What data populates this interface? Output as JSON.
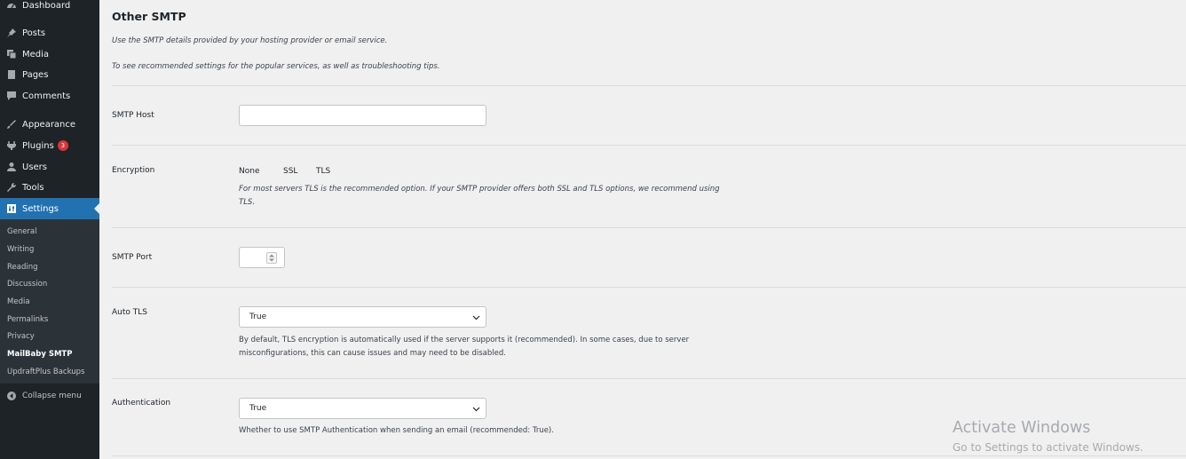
{
  "sidebar": {
    "items": [
      {
        "id": "dashboard",
        "label": "Dashboard",
        "icon": "dashboard-icon"
      },
      {
        "id": "posts",
        "label": "Posts",
        "icon": "pushpin-icon"
      },
      {
        "id": "media",
        "label": "Media",
        "icon": "media-icon"
      },
      {
        "id": "pages",
        "label": "Pages",
        "icon": "page-icon"
      },
      {
        "id": "comments",
        "label": "Comments",
        "icon": "comment-icon"
      },
      {
        "id": "appearance",
        "label": "Appearance",
        "icon": "brush-icon"
      },
      {
        "id": "plugins",
        "label": "Plugins",
        "icon": "plugin-icon",
        "badge": "3"
      },
      {
        "id": "users",
        "label": "Users",
        "icon": "user-icon"
      },
      {
        "id": "tools",
        "label": "Tools",
        "icon": "wrench-icon"
      },
      {
        "id": "settings",
        "label": "Settings",
        "icon": "settings-icon",
        "active": true
      }
    ],
    "submenu": [
      "General",
      "Writing",
      "Reading",
      "Discussion",
      "Media",
      "Permalinks",
      "Privacy",
      "MailBaby SMTP",
      "UpdraftPlus Backups"
    ],
    "current_submenu": "MailBaby SMTP",
    "collapse_label": "Collapse menu"
  },
  "main": {
    "title": "Other SMTP",
    "desc1": "Use the SMTP details provided by your hosting provider or email service.",
    "desc2": "To see recommended settings for the popular services, as well as troubleshooting tips.",
    "smtp_host": {
      "label": "SMTP Host",
      "value": ""
    },
    "encryption": {
      "label": "Encryption",
      "options": [
        "None",
        "SSL",
        "TLS"
      ],
      "help": "For most servers TLS is the recommended option. If your SMTP provider offers both SSL and TLS options, we recommend using TLS."
    },
    "smtp_port": {
      "label": "SMTP Port",
      "value": ""
    },
    "auto_tls": {
      "label": "Auto TLS",
      "value": "True",
      "help": "By default, TLS encryption is automatically used if the server supports it (recommended). In some cases, due to server misconfigurations, this can cause issues and may need to be disabled."
    },
    "authentication": {
      "label": "Authentication",
      "value": "True",
      "help": "Whether to use SMTP Authentication when sending an email (recommended: True)."
    }
  },
  "watermark": {
    "title": "Activate Windows",
    "subtitle": "Go to Settings to activate Windows."
  },
  "colors": {
    "sidebar_bg": "#1d2327",
    "active_bg": "#2271b1",
    "badge_bg": "#d63638",
    "page_bg": "#f0f0f1"
  }
}
